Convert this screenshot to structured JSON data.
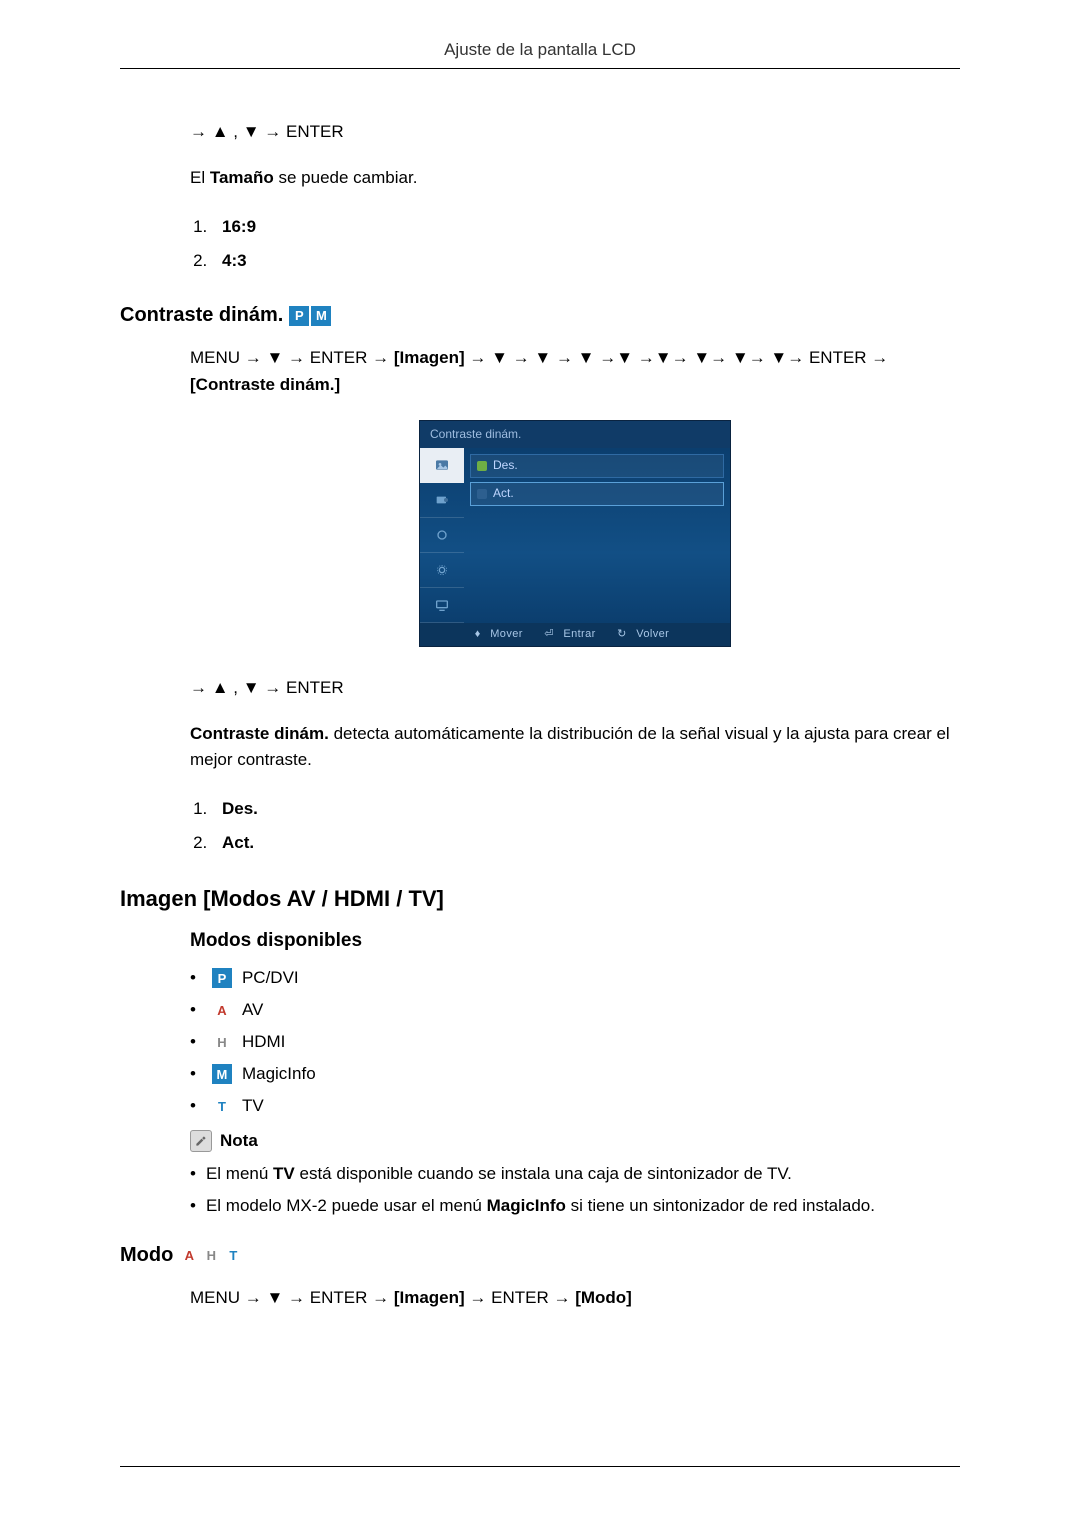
{
  "header": {
    "title": "Ajuste de la pantalla LCD"
  },
  "size_block": {
    "nav": "→ ▲ , ▼ → ENTER",
    "intro_pre": "El ",
    "intro_bold": "Tamaño",
    "intro_post": " se puede cambiar.",
    "items": [
      "16:9",
      "4:3"
    ]
  },
  "contrast_section": {
    "title": "Contraste dinám.",
    "badges": [
      "P",
      "M"
    ],
    "path_pre": "MENU → ▼ → ENTER → ",
    "path_bold1": "[Imagen]",
    "path_mid": " → ▼ → ▼ → ▼ →▼ →▼→ ▼→ ▼→ ▼→ ENTER → ",
    "path_bold2": "[Contraste dinám.]",
    "osd": {
      "title": "Contraste dinám.",
      "options": [
        "Des.",
        "Act."
      ],
      "footer": {
        "move": "Mover",
        "enter": "Entrar",
        "back": "Volver"
      }
    },
    "nav2": "→ ▲ , ▼ → ENTER",
    "desc_bold": "Contraste dinám.",
    "desc_rest": " detecta automáticamente la distribución de la señal visual y la ajusta para crear el mejor contraste.",
    "list": [
      "Des.",
      "Act."
    ]
  },
  "image_section": {
    "title": "Imagen [Modos AV / HDMI / TV]",
    "subtitle": "Modos disponibles",
    "modes": [
      {
        "badge": "P",
        "cls": "b-p",
        "label": "PC/DVI"
      },
      {
        "badge": "A",
        "cls": "b-a",
        "label": "AV"
      },
      {
        "badge": "H",
        "cls": "b-h",
        "label": "HDMI"
      },
      {
        "badge": "M",
        "cls": "b-m",
        "label": "MagicInfo"
      },
      {
        "badge": "T",
        "cls": "b-t",
        "label": "TV"
      }
    ],
    "note_label": "Nota",
    "notes_html": [
      "El menú <b>TV</b> está disponible cuando se instala una caja de sintonizador de TV.",
      "El modelo MX-2 puede usar el menú <b>MagicInfo</b> si tiene un sintonizador de red instalado."
    ]
  },
  "modo_section": {
    "title": "Modo",
    "badges": [
      {
        "badge": "A",
        "cls": "b-a"
      },
      {
        "badge": "H",
        "cls": "b-h"
      },
      {
        "badge": "T",
        "cls": "b-t"
      }
    ],
    "path_pre": "MENU → ▼ → ENTER → ",
    "path_bold1": "[Imagen]",
    "path_mid": " → ENTER → ",
    "path_bold2": "[Modo]"
  }
}
